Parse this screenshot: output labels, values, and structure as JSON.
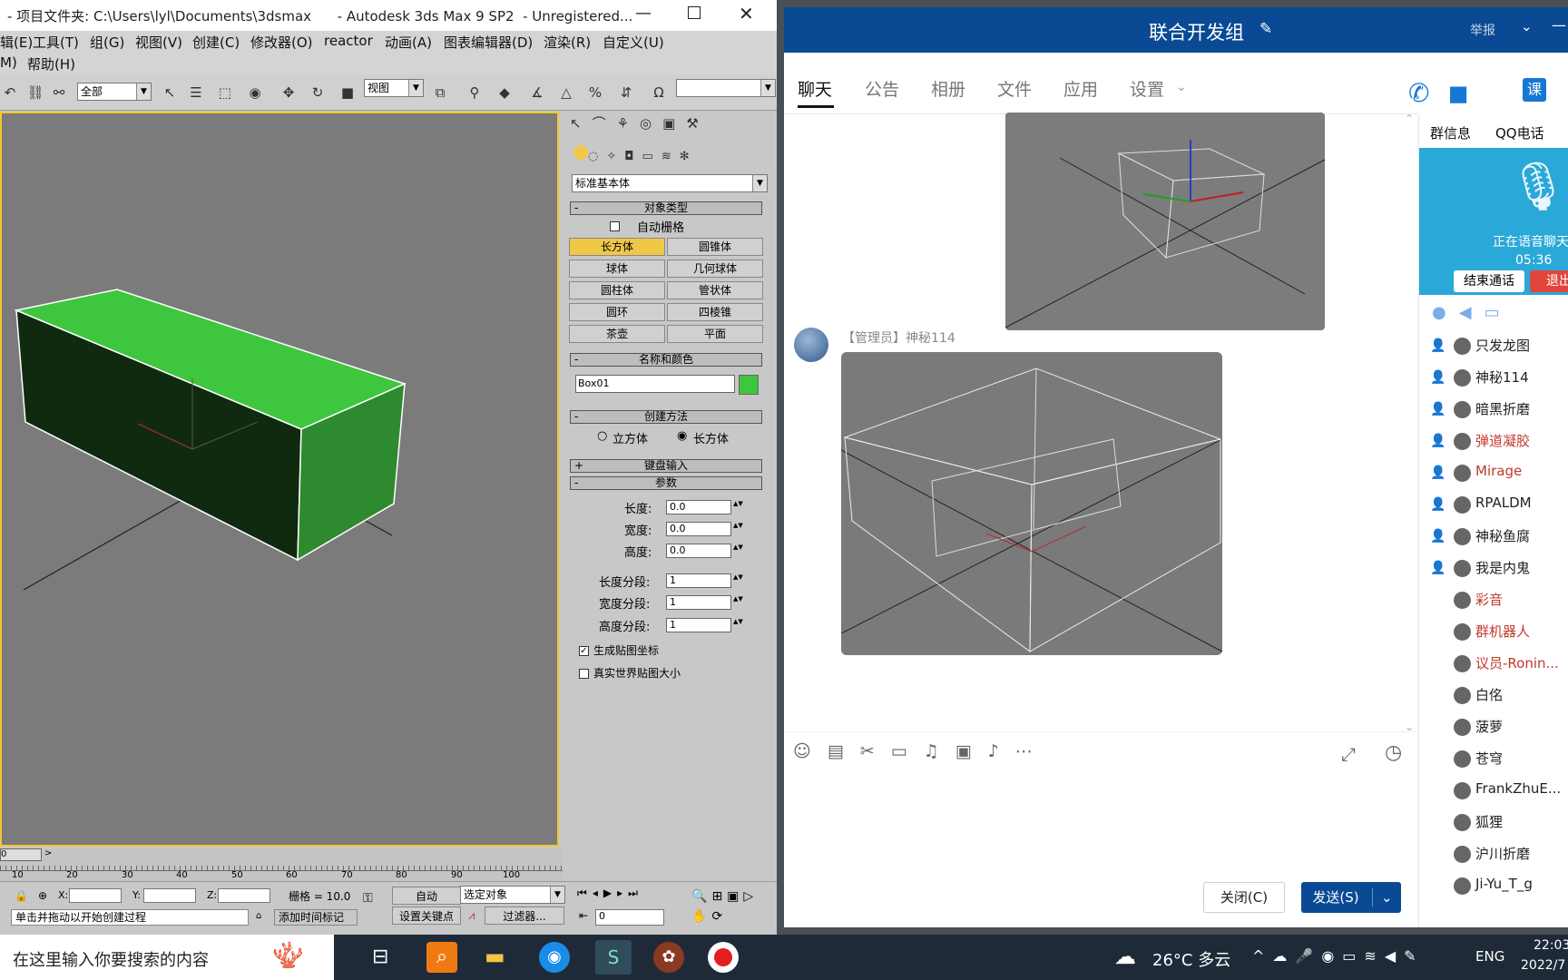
{
  "max": {
    "title": "- 项目文件夹: C:\\Users\\lyl\\Documents\\3dsmax      - Autodesk 3ds Max 9 SP2  - Unregistered...",
    "menu_row1": [
      "辑(E)",
      "工具(T)",
      "组(G)",
      "视图(V)",
      "创建(C)",
      "修改器(O)",
      "reactor",
      "动画(A)",
      "图表编辑器(D)",
      "渲染(R)",
      "自定义(U)"
    ],
    "menu_row2": [
      "M)",
      "帮助(H)"
    ],
    "selection_filter": "全部",
    "ref_coord": "视图",
    "panel": {
      "category": "标准基本体",
      "object_type_title": "对象类型",
      "autogrid": "自动栅格",
      "buttons": [
        "长方体",
        "圆锥体",
        "球体",
        "几何球体",
        "圆柱体",
        "管状体",
        "圆环",
        "四棱锥",
        "茶壶",
        "平面"
      ],
      "name_color_title": "名称和颜色",
      "object_name": "Box01",
      "object_color": "#3ec63e",
      "creation_method_title": "创建方法",
      "cube": "立方体",
      "box": "长方体",
      "keyboard_entry": "键盘输入",
      "params_title": "参数",
      "length_label": "长度:",
      "length": "0.0",
      "width_label": "宽度:",
      "width": "0.0",
      "height_label": "高度:",
      "height": "0.0",
      "lseg_label": "长度分段:",
      "lseg": "1",
      "wseg_label": "宽度分段:",
      "wseg": "1",
      "hseg_label": "高度分段:",
      "hseg": "1",
      "gen_map": "生成贴图坐标",
      "real_world": "真实世界贴图大小"
    },
    "timeline": {
      "slider": "0",
      "ticks": [
        "10",
        "20",
        "30",
        "40",
        "50",
        "60",
        "70",
        "80",
        "90",
        "100"
      ]
    },
    "status": {
      "x_label": "X:",
      "y_label": "Y:",
      "z_label": "Z:",
      "grid": "栅格 = 10.0",
      "auto": "自动",
      "selected": "选定对象",
      "set_key": "设置关键点",
      "filter": "过滤器...",
      "prompt": "单击并拖动以开始创建过程",
      "add_time_tag": "添加时间标记",
      "frame": "0"
    }
  },
  "qq": {
    "group_name": "联合开发组",
    "report": "举报",
    "tabs": [
      "聊天",
      "公告",
      "相册",
      "文件",
      "应用",
      "设置"
    ],
    "sender": "【管理员】神秘114",
    "side_tabs": [
      "群信息",
      "QQ电话"
    ],
    "call_status": "正在语音聊天",
    "call_time": "05:36",
    "end_call": "结束通话",
    "quit": "退出",
    "members": [
      {
        "name": "只发龙图",
        "color": "#222",
        "mic": true
      },
      {
        "name": "神秘114",
        "color": "#222",
        "mic": true
      },
      {
        "name": "暗黑折磨",
        "color": "#222",
        "mic": true
      },
      {
        "name": "弹道凝胶",
        "color": "#c0392b",
        "mic": true
      },
      {
        "name": "Mirage",
        "color": "#c0392b",
        "mic": true
      },
      {
        "name": "RPALDM",
        "color": "#222",
        "mic": true
      },
      {
        "name": "神秘鱼腐",
        "color": "#222",
        "mic": true
      },
      {
        "name": "我是内鬼",
        "color": "#222",
        "mic": true
      },
      {
        "name": "彩音",
        "color": "#c0392b",
        "mic": false
      },
      {
        "name": "群机器人",
        "color": "#c0392b",
        "mic": false
      },
      {
        "name": "议员-Ronin...",
        "color": "#c0392b",
        "mic": false
      },
      {
        "name": "白佲",
        "color": "#222",
        "mic": false
      },
      {
        "name": "菠萝",
        "color": "#222",
        "mic": false
      },
      {
        "name": "苍穹",
        "color": "#222",
        "mic": false
      },
      {
        "name": "FrankZhuE...",
        "color": "#222",
        "mic": false
      },
      {
        "name": "狐狸",
        "color": "#222",
        "mic": false
      },
      {
        "name": "沪川折磨",
        "color": "#222",
        "mic": false
      },
      {
        "name": "Ji-Yu_T_g",
        "color": "#222",
        "mic": false
      }
    ],
    "close_btn": "关闭(C)",
    "send_btn": "发送(S)"
  },
  "taskbar": {
    "search_placeholder": "在这里输入你要搜索的内容",
    "weather": "26°C 多云",
    "lang": "ENG",
    "time": "22:03",
    "date": "2022/7"
  }
}
